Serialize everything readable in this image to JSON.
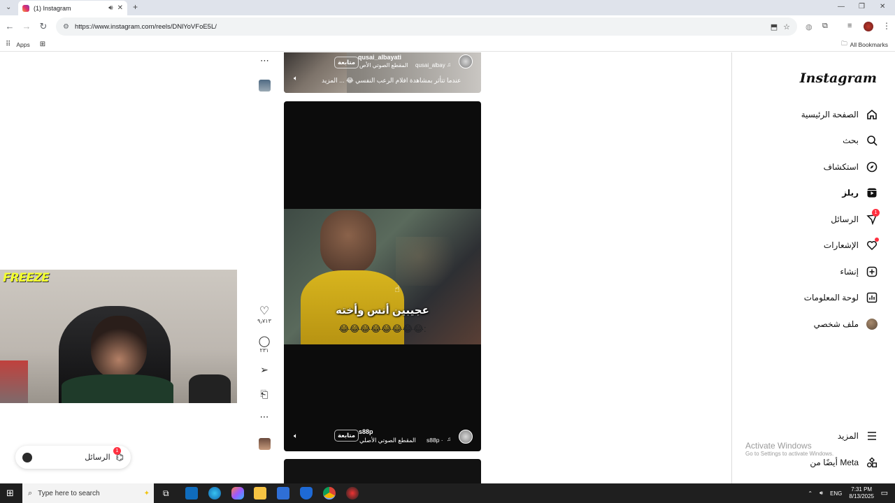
{
  "browser": {
    "tab_title": "(1) Instagram",
    "url": "https://www.instagram.com/reels/DNlYoVFoE5L/",
    "bookmarks": {
      "apps_label": "Apps",
      "all_bookmarks_label": "All Bookmarks"
    }
  },
  "sidebar": {
    "logo": "Instagram",
    "items": [
      {
        "label": "الصفحة الرئيسية",
        "icon": "home-icon"
      },
      {
        "label": "بحث",
        "icon": "search-icon"
      },
      {
        "label": "استكشاف",
        "icon": "compass-icon"
      },
      {
        "label": "ريلز",
        "icon": "reels-icon"
      },
      {
        "label": "الرسائل",
        "icon": "messages-icon",
        "badge": "1"
      },
      {
        "label": "الإشعارات",
        "icon": "heart-icon"
      },
      {
        "label": "إنشاء",
        "icon": "create-icon"
      },
      {
        "label": "لوحة المعلومات",
        "icon": "dashboard-icon"
      },
      {
        "label": "ملف شخصي",
        "icon": "avatar"
      }
    ],
    "more_label": "المزيد",
    "meta_label": "أيضًا من Meta"
  },
  "reel_top": {
    "username": "qusai_albayati",
    "follow_label": "متابعة",
    "audio": "المقطع الصوتي الأص",
    "audio_user": "qusai_albay",
    "caption": "عندما تتأثر بمشاهدة افلام الرعب النفسي 😂 ... المزيد"
  },
  "reel_main": {
    "overlay_line1": "عجيبين أنس وأخته",
    "overlay_line2": "😂😂😂😂😂😂😂😂:",
    "username": "s88p",
    "follow_label": "متابعة",
    "audio": "المقطع الصوتي الأصلي",
    "audio_user": "s88p ·",
    "actions": {
      "likes": "٩٫٧١٣",
      "comments": "٢٣١"
    }
  },
  "webcam": {
    "overlay_text": "FREEZE"
  },
  "messages_pill": {
    "label": "الرسائل",
    "badge": "1"
  },
  "watermark": {
    "title": "Activate Windows",
    "subtitle": "Go to Settings to activate Windows."
  },
  "taskbar": {
    "search_placeholder": "Type here to search",
    "language": "ENG",
    "time": "7:31 PM",
    "date": "8/13/2025"
  }
}
